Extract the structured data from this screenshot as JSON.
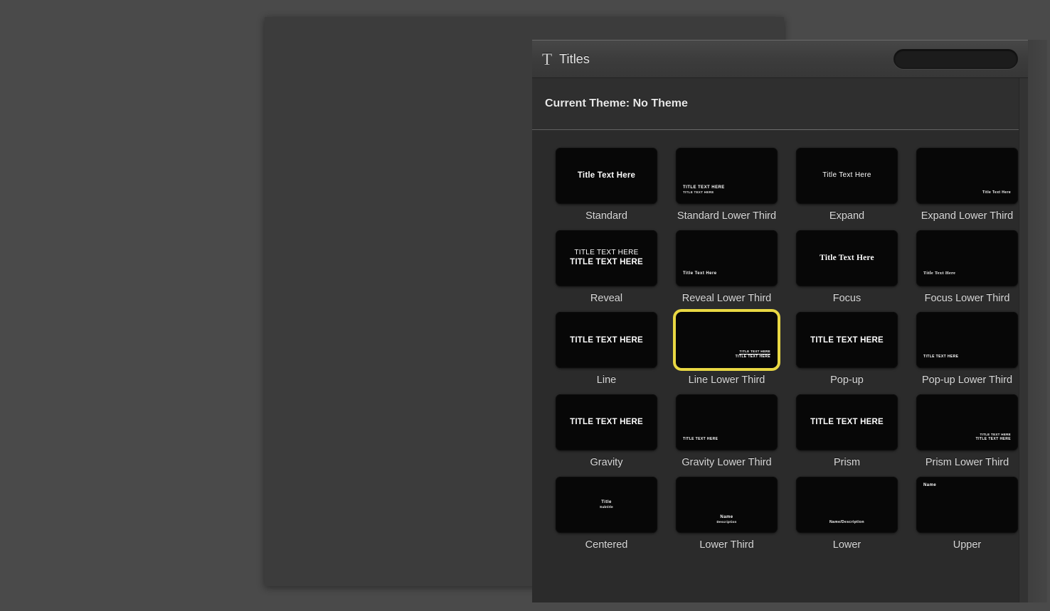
{
  "window": {
    "browser_title": "Titles",
    "type_icon": "T",
    "theme_label": "Current Theme: No Theme"
  },
  "search": {
    "icon": "search-icon",
    "value": "",
    "placeholder": ""
  },
  "colors": {
    "selection": "#e9d843",
    "panel_background": "#2b2b2b",
    "header_background": "#3c3c3c",
    "desktop_background": "#4a4a4a",
    "label_text": "#d8d8d8"
  },
  "effects": [
    {
      "label": "Standard",
      "selected": false,
      "position": "pos-center",
      "lines": [
        {
          "text": "Title Text Here",
          "cls": "sz-lg ff-sans"
        }
      ]
    },
    {
      "label": "Standard Lower Third",
      "selected": false,
      "position": "pos-lower-left",
      "lines": [
        {
          "text": "TITLE TEXT HERE",
          "cls": "sz-sm ff-sans up"
        },
        {
          "text": "TITLE TEXT HERE",
          "cls": "sz-tiny ff-sans up dim"
        }
      ]
    },
    {
      "label": "Expand",
      "selected": false,
      "position": "pos-center",
      "lines": [
        {
          "text": "Title Text Here",
          "cls": "sz-md ff-sans"
        }
      ]
    },
    {
      "label": "Expand Lower Third",
      "selected": false,
      "position": "pos-lower-right",
      "lines": [
        {
          "text": "Title Text Here",
          "cls": "sz-xs ff-sans"
        }
      ]
    },
    {
      "label": "Reveal",
      "selected": false,
      "position": "pos-center",
      "lines": [
        {
          "text": "TITLE TEXT HERE",
          "cls": "sz-md ff-sans up"
        },
        {
          "text": "TITLE TEXT HERE",
          "cls": "sz-lg ff-sans up"
        }
      ]
    },
    {
      "label": "Reveal Lower Third",
      "selected": false,
      "position": "pos-lower-left",
      "lines": [
        {
          "text": "Title Text Here",
          "cls": "sz-sm ff-sans"
        }
      ]
    },
    {
      "label": "Focus",
      "selected": false,
      "position": "pos-center",
      "lines": [
        {
          "text": "Title Text Here",
          "cls": "sz-lg ff-serif"
        }
      ]
    },
    {
      "label": "Focus Lower Third",
      "selected": false,
      "position": "pos-lower-left",
      "lines": [
        {
          "text": "Title Text Here",
          "cls": "sz-sm ff-serif"
        }
      ]
    },
    {
      "label": "Line",
      "selected": false,
      "position": "pos-center",
      "lines": [
        {
          "text": "TITLE TEXT HERE",
          "cls": "sz-lg ff-sans up"
        }
      ]
    },
    {
      "label": "Line Lower Third",
      "selected": true,
      "position": "pos-lower-right",
      "lines": [
        {
          "text": "TITLE TEXT HERE",
          "cls": "sz-tiny ff-sans up underlined"
        },
        {
          "text": "TITLE TEXT HERE",
          "cls": "sz-xs ff-sans up"
        }
      ]
    },
    {
      "label": "Pop-up",
      "selected": false,
      "position": "pos-center",
      "lines": [
        {
          "text": "TITLE TEXT HERE",
          "cls": "sz-lg ff-sans up"
        }
      ]
    },
    {
      "label": "Pop-up Lower Third",
      "selected": false,
      "position": "pos-lower-left",
      "lines": [
        {
          "text": "TITLE TEXT HERE",
          "cls": "sz-xs ff-sans up"
        }
      ]
    },
    {
      "label": "Gravity",
      "selected": false,
      "position": "pos-center",
      "lines": [
        {
          "text": "TITLE TEXT HERE",
          "cls": "sz-lg ff-sans up"
        }
      ]
    },
    {
      "label": "Gravity Lower Third",
      "selected": false,
      "position": "pos-lower-left",
      "lines": [
        {
          "text": "TITLE TEXT HERE",
          "cls": "sz-xs ff-sans up"
        }
      ]
    },
    {
      "label": "Prism",
      "selected": false,
      "position": "pos-center",
      "lines": [
        {
          "text": "TITLE TEXT HERE",
          "cls": "sz-lg ff-sans up"
        }
      ]
    },
    {
      "label": "Prism Lower Third",
      "selected": false,
      "position": "pos-lower-right",
      "lines": [
        {
          "text": "TITLE TEXT HERE",
          "cls": "sz-tiny ff-sans up"
        },
        {
          "text": "TITLE TEXT HERE",
          "cls": "sz-xs ff-sans up"
        }
      ]
    },
    {
      "label": "Centered",
      "selected": false,
      "position": "pos-center",
      "lines": [
        {
          "text": "Title",
          "cls": "sz-sm ff-sans"
        },
        {
          "text": "Subtitle",
          "cls": "sz-tiny ff-sans"
        }
      ]
    },
    {
      "label": "Lower Third",
      "selected": false,
      "position": "pos-lower-center",
      "lines": [
        {
          "text": "Name",
          "cls": "sz-sm ff-sans"
        },
        {
          "text": "Description",
          "cls": "sz-tiny ff-sans"
        }
      ]
    },
    {
      "label": "Lower",
      "selected": false,
      "position": "pos-lower-center",
      "lines": [
        {
          "text": "Name/Description",
          "cls": "sz-xs ff-sans"
        }
      ]
    },
    {
      "label": "Upper",
      "selected": false,
      "position": "pos-upper-left",
      "lines": [
        {
          "text": "Name",
          "cls": "sz-sm ff-sans"
        }
      ]
    }
  ]
}
